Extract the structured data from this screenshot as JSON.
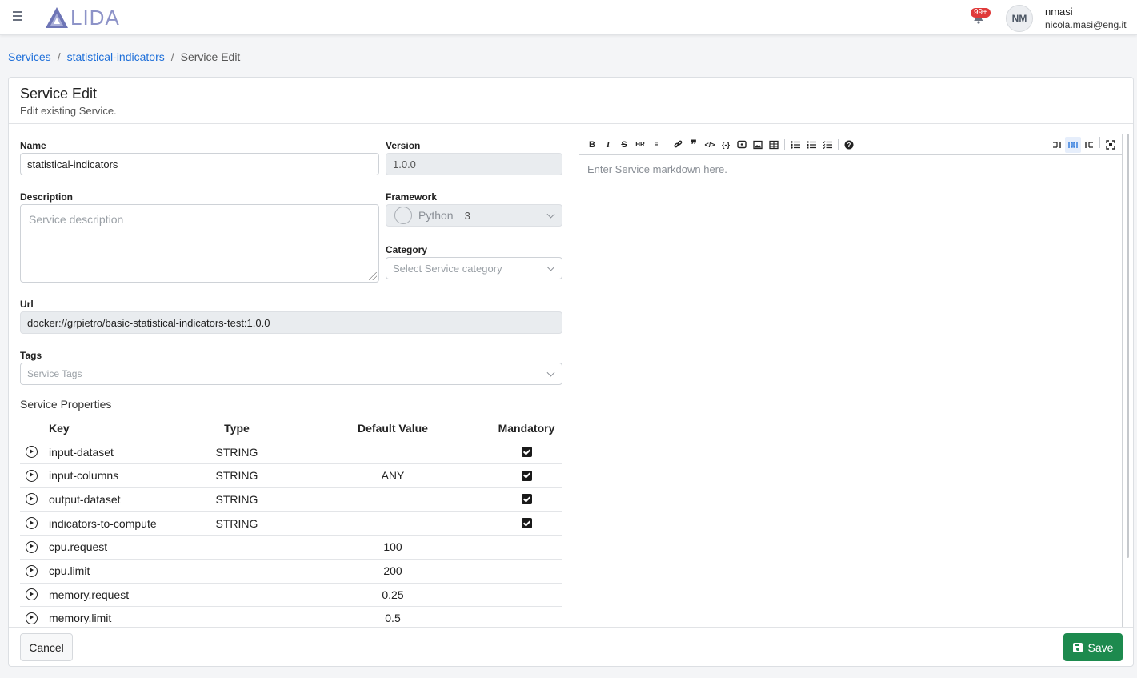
{
  "header": {
    "logo_text": "LIDA",
    "notification_badge": "99+",
    "user_initials": "NM",
    "user_name": "nmasi",
    "user_email": "nicola.masi@eng.it"
  },
  "breadcrumb": [
    "Services",
    "statistical-indicators",
    "Service Edit"
  ],
  "card": {
    "title": "Service Edit",
    "subtitle": "Edit existing Service."
  },
  "form": {
    "name_label": "Name",
    "name_value": "statistical-indicators",
    "version_label": "Version",
    "version_value": "1.0.0",
    "description_label": "Description",
    "description_placeholder": "Service description",
    "framework_label": "Framework",
    "framework_name": "Python",
    "framework_version": "3",
    "category_label": "Category",
    "category_placeholder": "Select Service category",
    "url_label": "Url",
    "url_value": "docker://grpietro/basic-statistical-indicators-test:1.0.0",
    "tags_label": "Tags",
    "tags_placeholder": "Service Tags"
  },
  "properties": {
    "title": "Service Properties",
    "columns": [
      "Key",
      "Type",
      "Default Value",
      "Mandatory"
    ],
    "rows": [
      {
        "key": "input-dataset",
        "type": "STRING",
        "default": "",
        "mandatory": true
      },
      {
        "key": "input-columns",
        "type": "STRING",
        "default": "ANY",
        "mandatory": true
      },
      {
        "key": "output-dataset",
        "type": "STRING",
        "default": "",
        "mandatory": true
      },
      {
        "key": "indicators-to-compute",
        "type": "STRING",
        "default": "",
        "mandatory": true
      },
      {
        "key": "cpu.request",
        "type": "",
        "default": "100",
        "mandatory": false
      },
      {
        "key": "cpu.limit",
        "type": "",
        "default": "200",
        "mandatory": false
      },
      {
        "key": "memory.request",
        "type": "",
        "default": "0.25",
        "mandatory": false
      },
      {
        "key": "memory.limit",
        "type": "",
        "default": "0.5",
        "mandatory": false
      }
    ]
  },
  "editor": {
    "placeholder": "Enter Service markdown here."
  },
  "actions": {
    "cancel": "Cancel",
    "save": "Save"
  },
  "colors": {
    "accent": "#1e6fd9",
    "save": "#1d8a4e",
    "badge": "#e03a3a",
    "logo": "#8d93c8"
  }
}
